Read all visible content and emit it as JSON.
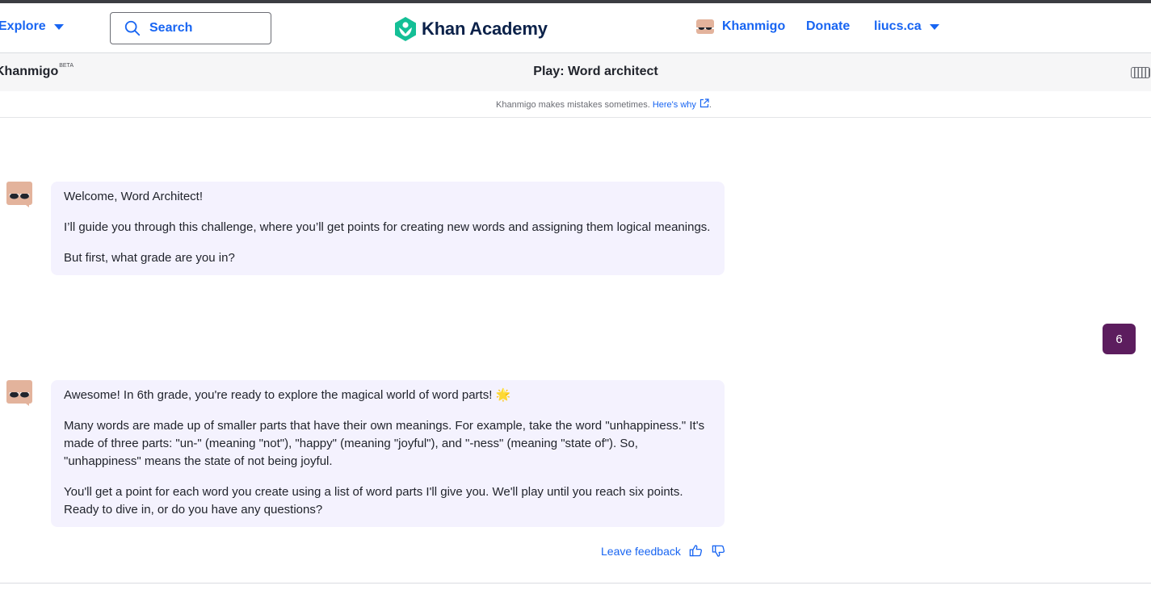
{
  "header": {
    "explore_label": "Explore",
    "search_label": "Search",
    "logo_text": "Khan Academy",
    "khanmigo_label": "Khanmigo",
    "donate_label": "Donate",
    "user_label": "liucs.ca"
  },
  "subheader": {
    "brand": "Khanmigo",
    "brand_badge": "BETA",
    "title": "Play: Word architect"
  },
  "disclaimer": {
    "text": "Khanmigo makes mistakes sometimes.",
    "link": "Here's why",
    "suffix": "."
  },
  "messages": [
    {
      "role": "assistant",
      "paragraphs": [
        "Welcome, Word Architect!",
        "I’ll guide you through this challenge, where you’ll get points for creating new words and assigning them logical meanings.",
        "But first, what grade are you in?"
      ]
    },
    {
      "role": "user",
      "text": "6"
    },
    {
      "role": "assistant",
      "paragraphs": [
        "Awesome! In 6th grade, you're ready to explore the magical world of word parts! 🌟",
        "Many words are made up of smaller parts that have their own meanings. For example, take the word \"unhappiness.\" It's made of three parts: \"un-\" (meaning \"not\"), \"happy\" (meaning \"joyful\"), and \"-ness\" (meaning \"state of\"). So, \"unhappiness\" means the state of not being joyful.",
        "You'll get a point for each word you create using a list of word parts I'll give you. We'll play until you reach six points. Ready to dive in, or do you have any questions?"
      ]
    }
  ],
  "feedback": {
    "label": "Leave feedback"
  },
  "icons": {
    "search": "search-icon",
    "logo": "khan-academy-logo-icon",
    "avatar": "khanmigo-avatar-icon",
    "external": "external-link-icon",
    "thumbs_up": "thumbs-up-icon",
    "thumbs_down": "thumbs-down-icon",
    "panel": "panel-toggle-icon"
  },
  "colors": {
    "accent": "#1865f2",
    "assistant_bubble": "#f4f2fe",
    "user_bubble": "#5c1d5e",
    "logo_green": "#14bf96",
    "subheader_bg": "#f6f6f7"
  }
}
